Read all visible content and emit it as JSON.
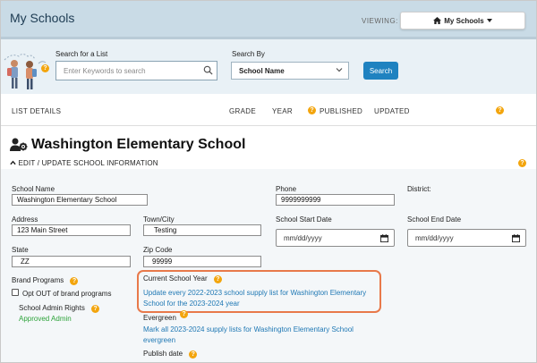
{
  "header": {
    "title": "My Schools",
    "viewing_label": "VIEWING:",
    "view_button_label": "My Schools"
  },
  "search": {
    "list_label": "Search for a List",
    "placeholder": "Enter Keywords to search",
    "by_label": "Search By",
    "by_selected": "School Name",
    "button_label": "Search"
  },
  "columns": {
    "list_details": "LIST DETAILS",
    "grade": "GRADE",
    "year": "YEAR",
    "published": "PUBLISHED",
    "updated": "UPDATED"
  },
  "school": {
    "name": "Washington Elementary School",
    "edit_label": "EDIT / UPDATE SCHOOL INFORMATION"
  },
  "form": {
    "school_name_label": "School Name",
    "school_name_value": "Washington Elementary School",
    "phone_label": "Phone",
    "phone_value": "9999999999",
    "district_label": "District:",
    "address_label": "Address",
    "address_value": "123 Main Street",
    "town_label": "Town/City",
    "town_value": "Testing",
    "start_date_label": "School Start Date",
    "start_date_value": "mm/dd/yyyy",
    "end_date_label": "School End Date",
    "end_date_value": "mm/dd/yyyy",
    "state_label": "State",
    "state_value": "ZZ",
    "zip_label": "Zip Code",
    "zip_value": "99999",
    "brand_label": "Brand Programs",
    "opt_out_label": "Opt OUT of brand programs",
    "admin_rights_label": "School Admin Rights",
    "admin_rights_value": "Approved Admin",
    "current_year_label": "Current School Year",
    "current_year_link_1": "Update every 2022-2023 school supply list for Washington Elementary",
    "current_year_link_2": "School for the 2023-2024 year",
    "evergreen_label": "Evergreen",
    "evergreen_link_1": "Mark all 2023-2024 supply lists for Washington Elementary School",
    "evergreen_link_2": "evergreen",
    "publish_label": "Publish date"
  },
  "help_glyph": "?",
  "colors": {
    "accent": "#1f82c0",
    "help": "#f3a50d",
    "highlight": "#e8794a",
    "link": "#1f78b4",
    "approved": "#2da33a"
  }
}
